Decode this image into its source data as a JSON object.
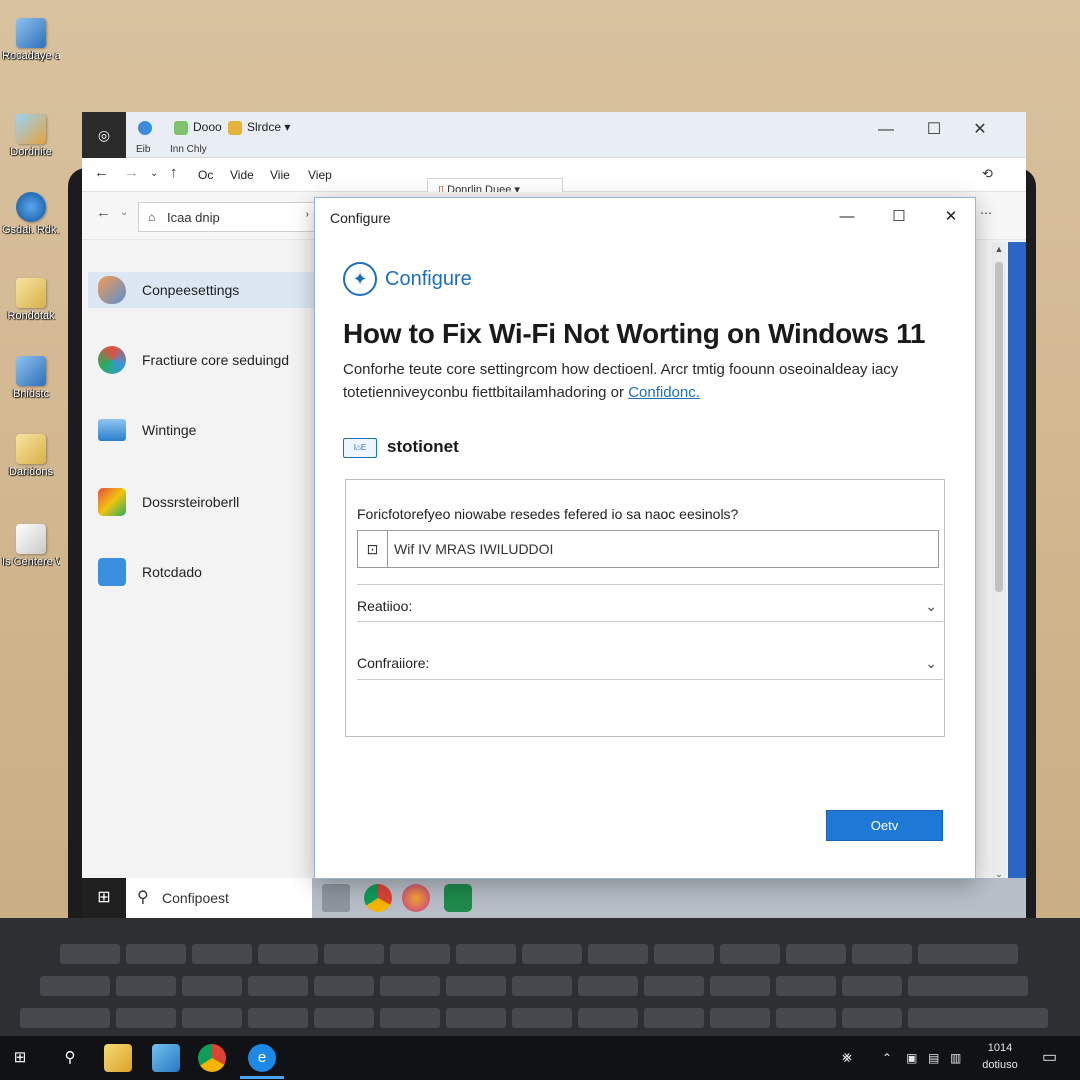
{
  "desktop": {
    "icons": [
      {
        "label": "Rocadaye ahkdec",
        "kind": "computer"
      },
      {
        "label": "Dordnite",
        "kind": "network"
      },
      {
        "label": "Gsdai. Rdk. B",
        "kind": "app"
      },
      {
        "label": "Rondotak",
        "kind": "folder"
      },
      {
        "label": "Bnidstc",
        "kind": "computer"
      },
      {
        "label": "Daridons",
        "kind": "doc"
      },
      {
        "label": "Is Centere Windos",
        "kind": "doc"
      }
    ]
  },
  "explorer": {
    "quick_access": [
      {
        "label": "Dooo",
        "sub": "Inn Chly"
      },
      {
        "label": "Slrdce"
      }
    ],
    "quick_sub_0": "Eib",
    "menu": [
      "Oc",
      "Vide",
      "Viie",
      "Viep"
    ],
    "address": "Icaa dnip",
    "tab_chip": "Donrlin Duee",
    "sidebar": [
      {
        "label": "Conpeesettings",
        "active": true
      },
      {
        "label": "Fractiure core seduingd"
      },
      {
        "label": "Wintinge"
      },
      {
        "label": "Dossrsteiroberll"
      },
      {
        "label": "Rotcdado"
      }
    ]
  },
  "taskbar_inner": {
    "search_text": "Confipoest"
  },
  "dialog": {
    "window_title": "Configure",
    "brand": "Configure",
    "heading": "How to Fix Wi-Fi Not Worting on Windows 11",
    "description": "Conforhe teute core settingrcom how dectioenl. Arcr tmtig foounn oseoinaldeay iacy totetienniveyconbu fiettbitailamhadoring or",
    "description_link": "Confidonc.",
    "section_label": "stotionet",
    "section_icon_text": "I⌂E",
    "form": {
      "question": "Foricfotorefyeo niowabe resedes fefered io sa naoc eesinols?",
      "input_value": "Wif IV MRAS IWILUDDOI",
      "select_1_label": "Reatiioo:",
      "select_2_label": "Confraiiore:"
    },
    "ok_label": "Oetv"
  },
  "desktop_taskbar": {
    "tray_glyph": "⨳",
    "clock_line1": "1014",
    "clock_line2": "dotiuso"
  },
  "icons": {
    "close": "close-icon",
    "minimize": "minimize-icon",
    "maximize": "maximize-icon",
    "search": "search-icon",
    "chevron": "chevron-down-icon",
    "windows": "windows-logo-icon"
  },
  "colors": {
    "accent": "#1e78d6",
    "brand": "#1e6fb8",
    "wall": "#d9c29f"
  }
}
